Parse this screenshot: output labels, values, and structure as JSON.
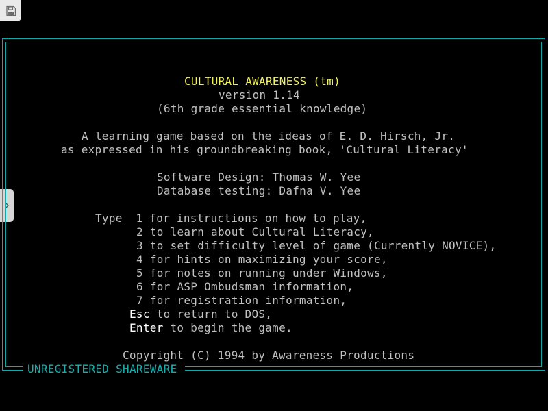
{
  "screen": {
    "title": "CULTURAL AWARENESS (tm)",
    "version": "version 1.14",
    "subtitle": "(6th grade essential knowledge)",
    "intro_line1": "A learning game based on the ideas of E. D. Hirsch, Jr.",
    "intro_line2": "as expressed in his groundbreaking book, 'Cultural Literacy'",
    "credit_design": "Software Design: Thomas W. Yee",
    "credit_testing": "Database testing: Dafna V. Yee",
    "menu": [
      "Type  1 for instructions on how to play,",
      "2 to learn about Cultural Literacy,",
      "3 to set difficulty level of game (Currently NOVICE),",
      "4 for hints on maximizing your score,",
      "5 for notes on running under Windows,",
      "6 for ASP Ombudsman information,",
      "7 for registration information,"
    ],
    "esc_key": "Esc",
    "esc_text": " to return to DOS,",
    "enter_key": "Enter",
    "enter_text": " to begin the game.",
    "copyright": "Copyright (C) 1994 by Awareness Productions",
    "status": "UNREGISTERED SHAREWARE"
  },
  "icons": {
    "save": "floppy-disk-icon",
    "expand": "chevron-right-icon"
  },
  "colors": {
    "background": "#000000",
    "text": "#c0c0c0",
    "title": "#f2f25a",
    "highlight": "#ffffff",
    "frame": "#11a8a8"
  }
}
